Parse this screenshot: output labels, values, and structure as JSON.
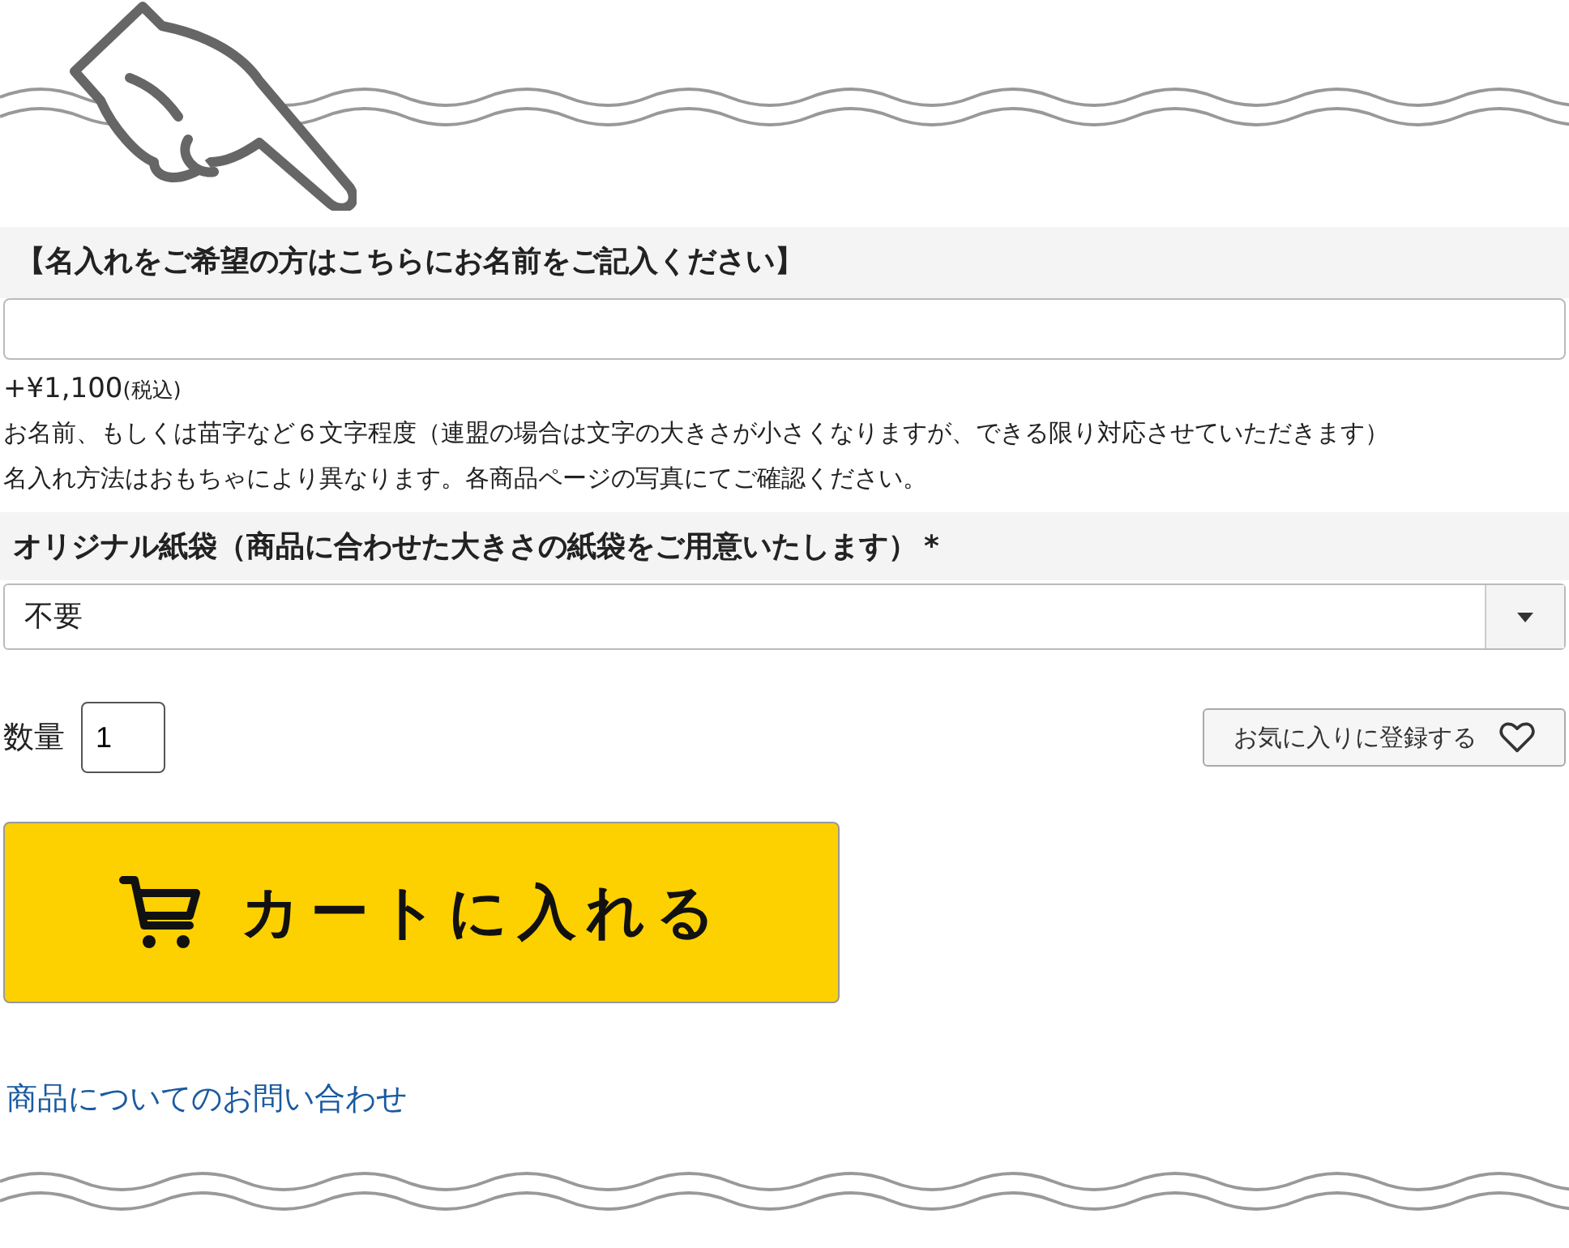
{
  "name_section": {
    "heading": "【名入れをご希望の方はこちらにお名前をご記入ください】",
    "price": "+¥1,100",
    "tax": "(税込)",
    "notes": [
      "お名前、もしくは苗字など６文字程度（連盟の場合は文字の大きさが小さくなりますが、できる限り対応させていただきます）",
      "名入れ方法はおもちゃにより異なります。各商品ページの写真にてご確認ください。"
    ]
  },
  "bag_section": {
    "heading": "オリジナル紙袋（商品に合わせた大きさの紙袋をご用意いたします）",
    "required_mark": "*",
    "value": "不要"
  },
  "quantity": {
    "label": "数量",
    "value": "1"
  },
  "favorite_button": {
    "label": "お気に入りに登録する"
  },
  "cart_button": {
    "label": "カートに入れる"
  },
  "inquiry_link": "商品についてのお問い合わせ"
}
